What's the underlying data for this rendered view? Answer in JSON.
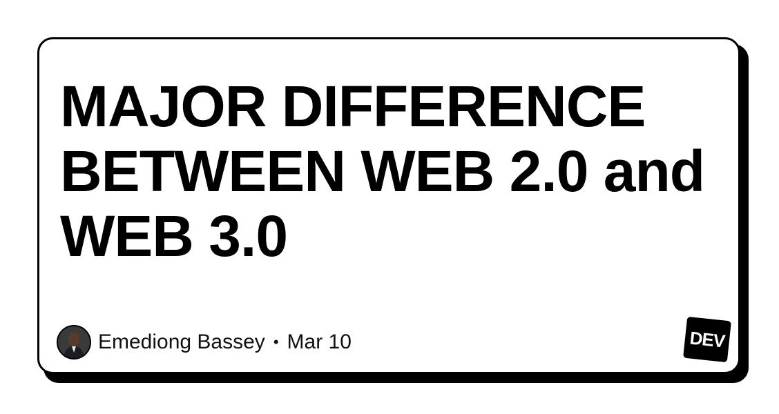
{
  "card": {
    "title": "MAJOR DIFFERENCE BETWEEN WEB 2.0 and WEB 3.0",
    "author": "Emediong Bassey",
    "separator": "•",
    "date": "Mar 10",
    "logo_text": "DEV"
  },
  "colors": {
    "background": "#ffffff",
    "card_border": "#000000",
    "card_shadow": "#000000",
    "text": "#000000",
    "logo_bg": "#000000",
    "logo_text": "#ffffff"
  },
  "icons": {
    "avatar": "author-avatar",
    "logo": "dev-logo"
  }
}
